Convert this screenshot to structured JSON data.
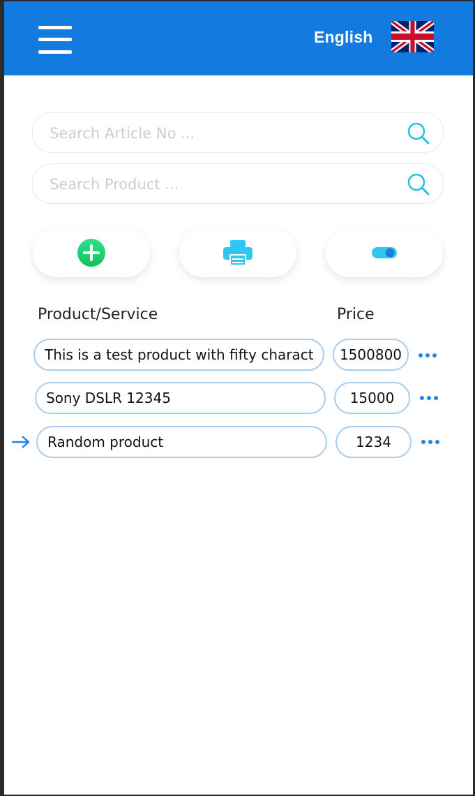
{
  "header": {
    "language_label": "English",
    "menu_icon": "hamburger-menu-icon",
    "flag_icon": "uk-flag-icon"
  },
  "search": {
    "article_placeholder": "Search Article No ...",
    "product_placeholder": "Search Product ...",
    "icon": "search-icon"
  },
  "actions": {
    "add_icon": "plus-circle-icon",
    "print_icon": "printer-icon",
    "toggle_icon": "toggle-icon"
  },
  "table": {
    "col_product": "Product/Service",
    "col_price": "Price",
    "rows": [
      {
        "product": "This is a test product with fifty characters",
        "price": "1500800"
      },
      {
        "product": "Sony DSLR 12345",
        "price": "15000"
      },
      {
        "product": "Random product",
        "price": "1234"
      }
    ]
  },
  "colors": {
    "header_bg": "#137ae0",
    "accent": "#1f86e8",
    "add_green": "#1ed36f",
    "search_icon_teal": "#1fc4dc",
    "printer": "#2fc7f2"
  }
}
